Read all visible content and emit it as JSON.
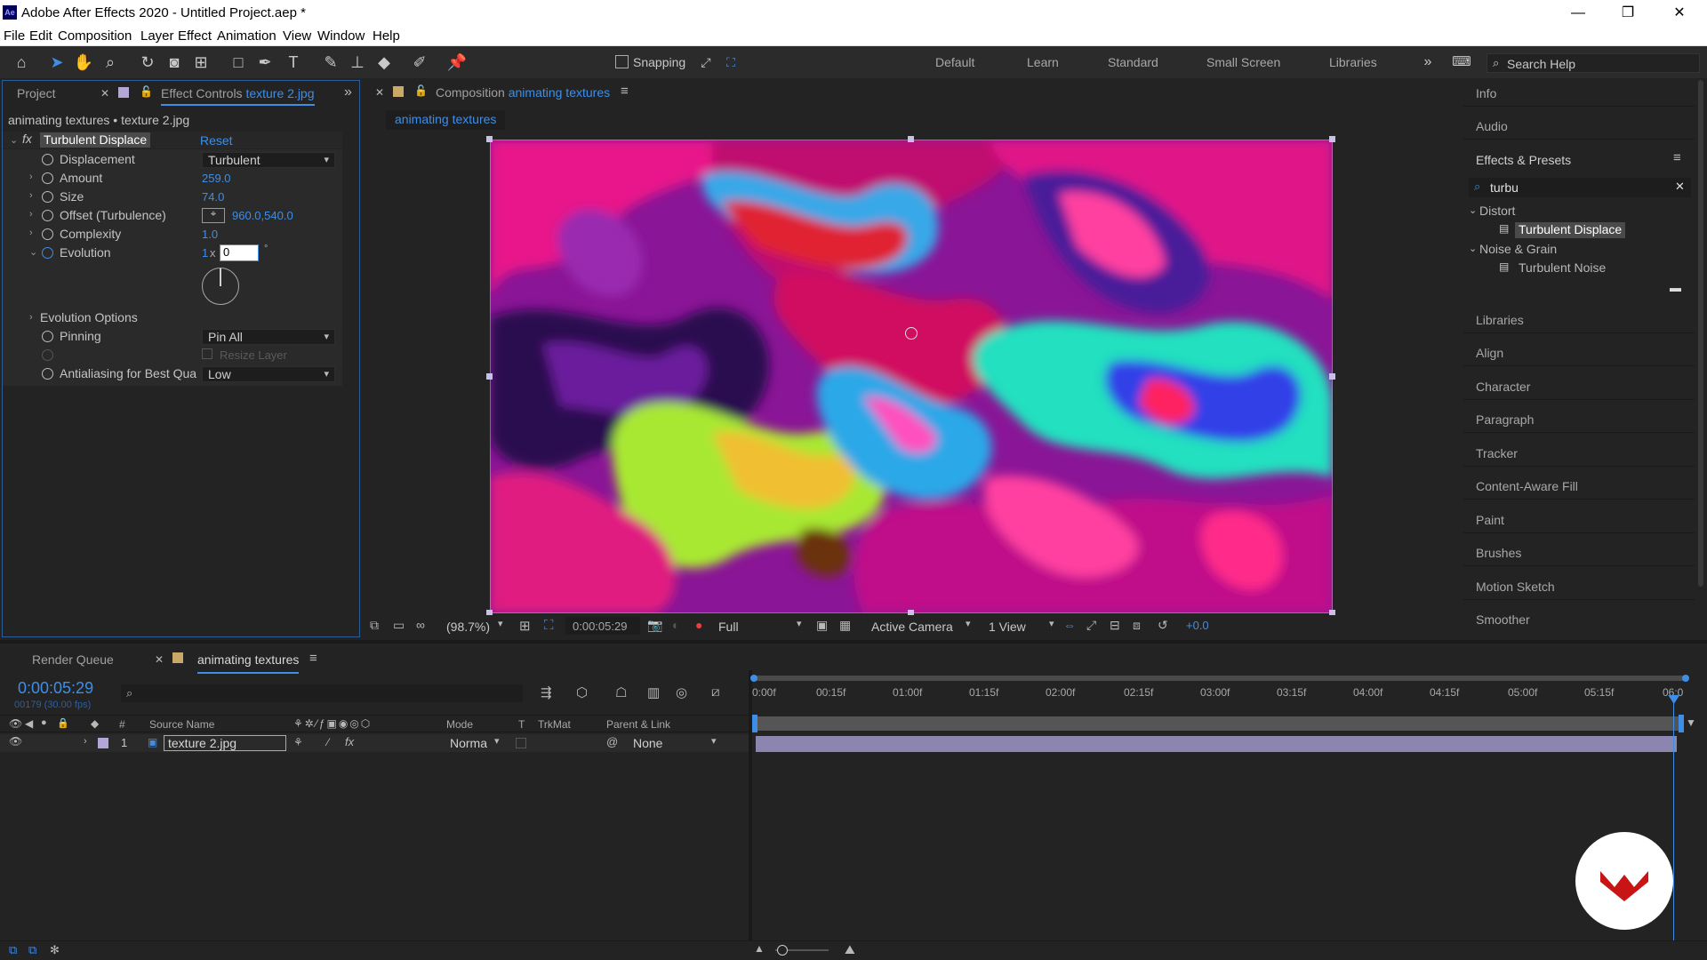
{
  "window": {
    "title": "Adobe After Effects 2020 - Untitled Project.aep *",
    "logo": "Ae",
    "minimize": "—",
    "maximize": "❐",
    "close": "✕"
  },
  "menu": [
    "File",
    "Edit",
    "Composition",
    "Layer",
    "Effect",
    "Animation",
    "View",
    "Window",
    "Help"
  ],
  "toolbar": {
    "snapping_label": "Snapping",
    "workspaces": [
      "Default",
      "Learn",
      "Standard",
      "Small Screen",
      "Libraries"
    ],
    "search_placeholder": "Search Help"
  },
  "left_panel": {
    "tab_project": "Project",
    "tab_effect_controls_prefix": "Effect Controls",
    "tab_effect_controls_layer": "texture 2.jpg",
    "context": "animating textures • texture 2.jpg",
    "effect_name": "Turbulent Displace",
    "reset": "Reset",
    "fx_label": "fx",
    "properties": {
      "displacement": {
        "label": "Displacement",
        "value": "Turbulent"
      },
      "amount": {
        "label": "Amount",
        "value": "259.0"
      },
      "size": {
        "label": "Size",
        "value": "74.0"
      },
      "offset": {
        "label": "Offset (Turbulence)",
        "value": "960.0,540.0"
      },
      "complexity": {
        "label": "Complexity",
        "value": "1.0"
      },
      "evolution": {
        "label": "Evolution",
        "revolutions": "1",
        "x": "x",
        "degrees": "0",
        "degree_symbol": "°"
      },
      "evolution_options": {
        "label": "Evolution Options"
      },
      "pinning": {
        "label": "Pinning",
        "value": "Pin All"
      },
      "resize_layer": {
        "label": "Resize Layer",
        "checked": false
      },
      "antialiasing": {
        "label": "Antialiasing for Best Qua",
        "value": "Low"
      }
    }
  },
  "comp_panel": {
    "tab_prefix": "Composition",
    "tab_comp": "animating textures",
    "breadcrumb": "animating textures",
    "footer": {
      "zoom": "(98.7%)",
      "timecode": "0:00:05:29",
      "resolution": "Full",
      "camera": "Active Camera",
      "views": "1 View",
      "exposure": "+0.0"
    }
  },
  "right_panel": {
    "info": "Info",
    "audio": "Audio",
    "effects_presets": "Effects & Presets",
    "search_value": "turbu",
    "tree": [
      {
        "category": "Distort",
        "items": [
          "Turbulent Displace"
        ]
      },
      {
        "category": "Noise & Grain",
        "items": [
          "Turbulent Noise"
        ]
      }
    ],
    "panels": [
      "Libraries",
      "Align",
      "Character",
      "Paragraph",
      "Tracker",
      "Content-Aware Fill",
      "Paint",
      "Brushes",
      "Motion Sketch",
      "Smoother"
    ]
  },
  "timeline": {
    "tab_render_queue": "Render Queue",
    "tab_comp": "animating textures",
    "timecode": "0:00:05:29",
    "frame_info": "00179 (30.00 fps)",
    "columns": {
      "hash": "#",
      "source_name": "Source Name",
      "mode": "Mode",
      "t": "T",
      "trkmat": "TrkMat",
      "parent": "Parent & Link"
    },
    "layers": [
      {
        "index": "1",
        "name": "texture 2.jpg",
        "mode": "Norma",
        "parent": "None",
        "label_color": "#b4a6d8"
      }
    ],
    "ruler": [
      "0:00f",
      "00:15f",
      "01:00f",
      "01:15f",
      "02:00f",
      "02:15f",
      "03:00f",
      "03:15f",
      "04:00f",
      "04:15f",
      "05:00f",
      "05:15f",
      "06:0"
    ],
    "current_time_fraction": 0.9945
  },
  "colors": {
    "accent": "#3e8ee8",
    "layer_bar": "#8c85b0",
    "watermark": "#c81414"
  },
  "icons": [
    "home-icon",
    "selection-icon",
    "hand-icon",
    "zoom-icon",
    "rotate-icon",
    "camera-icon",
    "pan-behind-icon",
    "rectangle-icon",
    "pen-icon",
    "text-icon",
    "brush-icon",
    "clone-stamp-icon",
    "eraser-icon",
    "roto-brush-icon",
    "puppet-pin-icon"
  ]
}
